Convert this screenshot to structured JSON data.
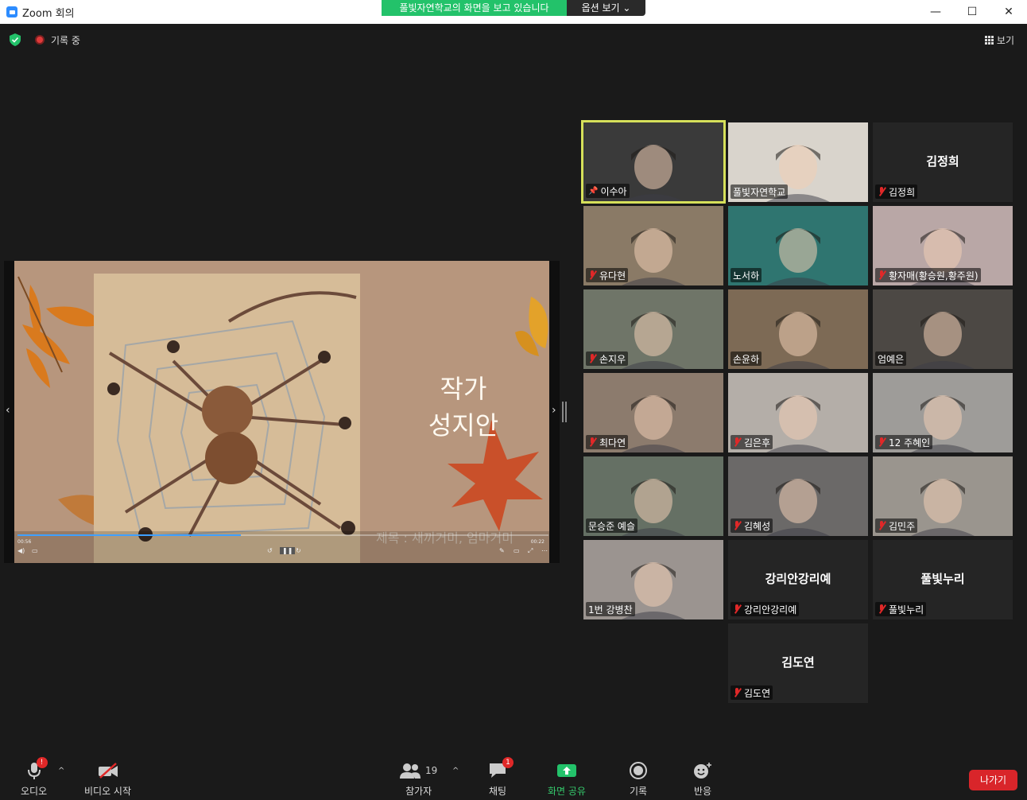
{
  "window": {
    "title": "Zoom 회의",
    "minimize": "—",
    "maximize": "☐",
    "close": "✕"
  },
  "share_banner": {
    "viewing_text": "풀빛자연학교의 화면을 보고 있습니다",
    "options_label": "옵션 보기 ⌄"
  },
  "status": {
    "recording_label": "기록 중",
    "view_label": "보기"
  },
  "shared_content": {
    "author_line1": "작가",
    "author_line2": "성지안",
    "caption": "제목 : 새끼거미, 엄마거미",
    "time_elapsed": "00:56",
    "time_total": "00:22",
    "progress": 0.42
  },
  "participants": [
    {
      "name": "이수아",
      "active": true,
      "muted": false,
      "pinned": true,
      "bg": "#3a3a3a",
      "center_name": ""
    },
    {
      "name": "풀빛자연학교",
      "active": false,
      "muted": false,
      "pinned": false,
      "bg": "#d9d4cc",
      "center_name": ""
    },
    {
      "name": "김정희",
      "active": false,
      "muted": true,
      "pinned": false,
      "bg": "#252525",
      "center_name": "김정희"
    },
    {
      "name": "유다현",
      "active": false,
      "muted": true,
      "pinned": false,
      "bg": "#8a7a66",
      "center_name": ""
    },
    {
      "name": "노서하",
      "active": false,
      "muted": false,
      "pinned": false,
      "bg": "#2f7570",
      "center_name": ""
    },
    {
      "name": "황자매(황승원,황주원)",
      "active": false,
      "muted": true,
      "pinned": false,
      "bg": "#b9a7a6",
      "center_name": ""
    },
    {
      "name": "손지우",
      "active": false,
      "muted": true,
      "pinned": false,
      "bg": "#6f7568",
      "center_name": ""
    },
    {
      "name": "손윤하",
      "active": false,
      "muted": false,
      "pinned": false,
      "bg": "#7d6a55",
      "center_name": ""
    },
    {
      "name": "엄예은",
      "active": false,
      "muted": false,
      "pinned": false,
      "bg": "#4c4844",
      "center_name": ""
    },
    {
      "name": "최다연",
      "active": false,
      "muted": true,
      "pinned": false,
      "bg": "#8c7b6d",
      "center_name": ""
    },
    {
      "name": "김은후",
      "active": false,
      "muted": true,
      "pinned": false,
      "bg": "#b4aea8",
      "center_name": ""
    },
    {
      "name": "12 주혜인",
      "active": false,
      "muted": true,
      "pinned": false,
      "bg": "#9e9c99",
      "center_name": ""
    },
    {
      "name": "문승준 예슬",
      "active": false,
      "muted": false,
      "pinned": false,
      "bg": "#657064",
      "center_name": ""
    },
    {
      "name": "김혜성",
      "active": false,
      "muted": true,
      "pinned": false,
      "bg": "#6b6968",
      "center_name": ""
    },
    {
      "name": "김민주",
      "active": false,
      "muted": true,
      "pinned": false,
      "bg": "#9a958e",
      "center_name": ""
    },
    {
      "name": "1번 강병찬",
      "active": false,
      "muted": false,
      "pinned": false,
      "bg": "#9b9490",
      "center_name": ""
    },
    {
      "name": "강리안강리예",
      "active": false,
      "muted": true,
      "pinned": false,
      "bg": "#252525",
      "center_name": "강리안강리예"
    },
    {
      "name": "풀빛누리",
      "active": false,
      "muted": true,
      "pinned": false,
      "bg": "#252525",
      "center_name": "풀빛누리"
    },
    {
      "name": "김도연",
      "active": false,
      "muted": true,
      "pinned": false,
      "bg": "#252525",
      "center_name": "김도연"
    }
  ],
  "toolbar": {
    "audio_label": "오디오",
    "audio_badge": "!",
    "video_label": "비디오 시작",
    "participants_label": "참가자",
    "participants_count": "19",
    "chat_label": "채팅",
    "chat_badge": "1",
    "share_label": "화면 공유",
    "record_label": "기록",
    "reactions_label": "반응",
    "leave_label": "나가기"
  },
  "colors": {
    "share_green": "#23c26a",
    "active_speaker": "#d6e05a",
    "leave_red": "#d9252a",
    "muted_red": "#e02828"
  }
}
